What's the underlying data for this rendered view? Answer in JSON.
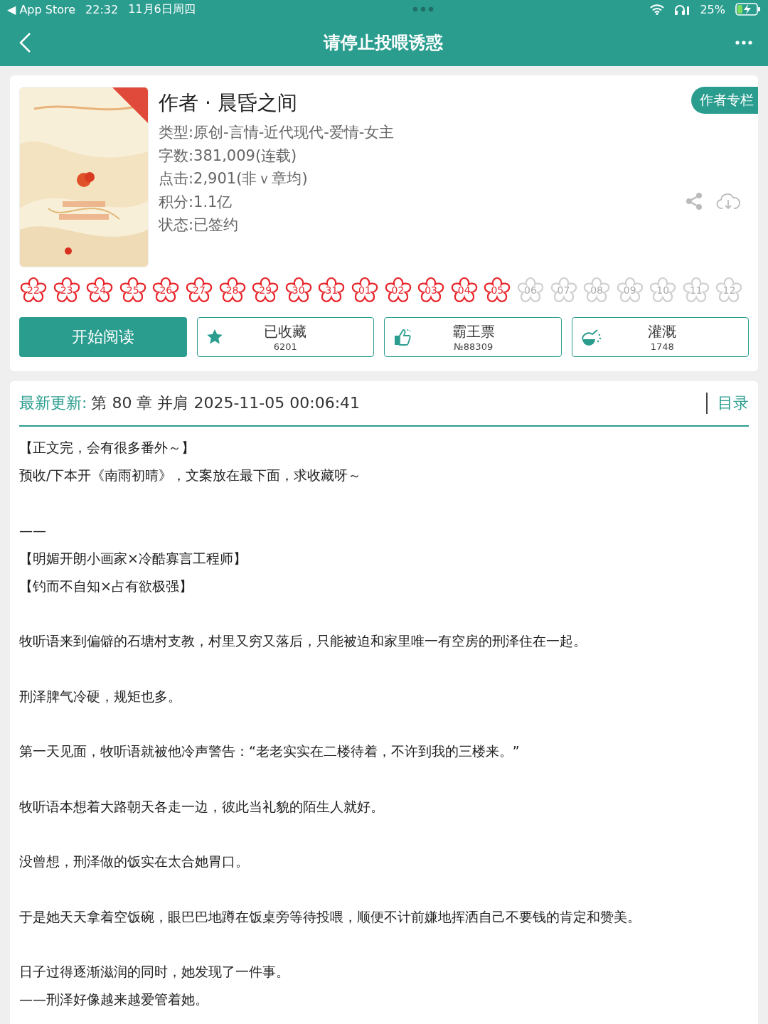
{
  "status_bar": {
    "back_app": "◀ App Store",
    "time": "22:32",
    "date": "11月6日周四",
    "battery": "25%"
  },
  "nav": {
    "title": "请停止投喂诱惑"
  },
  "book": {
    "author": "作者 · 晨昏之间",
    "author_button": "作者专栏",
    "info": [
      "类型:原创-言情-近代现代-爱情-女主",
      "字数:381,009(连载)",
      "点击:2,901(非ｖ章均)",
      "积分:1.1亿",
      "状态:已签约"
    ]
  },
  "days": [
    {
      "label": "22",
      "on": true
    },
    {
      "label": "23",
      "on": true
    },
    {
      "label": "24",
      "on": true
    },
    {
      "label": "25",
      "on": true
    },
    {
      "label": "26",
      "on": true
    },
    {
      "label": "27",
      "on": true
    },
    {
      "label": "28",
      "on": true
    },
    {
      "label": "29",
      "on": true
    },
    {
      "label": "30",
      "on": true
    },
    {
      "label": "31",
      "on": true
    },
    {
      "label": "01",
      "on": true
    },
    {
      "label": "02",
      "on": true
    },
    {
      "label": "03",
      "on": true
    },
    {
      "label": "04",
      "on": true
    },
    {
      "label": "05",
      "on": true
    },
    {
      "label": "06",
      "on": false
    },
    {
      "label": "07",
      "on": false
    },
    {
      "label": "08",
      "on": false
    },
    {
      "label": "09",
      "on": false
    },
    {
      "label": "10",
      "on": false
    },
    {
      "label": "11",
      "on": false
    },
    {
      "label": "12",
      "on": false
    }
  ],
  "read_button": "开始阅读",
  "actions": [
    {
      "kind": "star",
      "label": "已收藏",
      "count": "6201"
    },
    {
      "kind": "thumb",
      "label": "霸王票",
      "count": "№88309"
    },
    {
      "kind": "flask",
      "label": "灌溉",
      "count": "1748"
    }
  ],
  "update": {
    "label": "最新更新:",
    "value": "第 80 章 并肩 2025-11-05 00:06:41",
    "toc": "目录"
  },
  "intro": [
    [
      "【正文完，会有很多番外～】",
      "预收/下本开《南雨初晴》，文案放在最下面，求收藏呀～"
    ],
    [
      "——",
      "【明媚开朗小画家×冷酷寡言工程师】",
      "【钓而不自知×占有欲极强】"
    ],
    [
      "牧听语来到偏僻的石塘村支教，村里又穷又落后，只能被迫和家里唯一有空房的刑泽住在一起。"
    ],
    [
      "刑泽脾气冷硬，规矩也多。"
    ],
    [
      "第一天见面，牧听语就被他冷声警告：“老老实实在二楼待着，不许到我的三楼来。”"
    ],
    [
      "牧听语本想着大路朝天各走一边，彼此当礼貌的陌生人就好。"
    ],
    [
      "没曾想，刑泽做的饭实在太合她胃口。"
    ],
    [
      "于是她天天拿着空饭碗，眼巴巴地蹲在饭桌旁等待投喂，顺便不计前嫌地挥洒自己不要钱的肯定和赞美。"
    ],
    [
      "日子过得逐渐滋润的同时，她发现了一件事。",
      "——刑泽好像越来越爱管着她。"
    ]
  ]
}
